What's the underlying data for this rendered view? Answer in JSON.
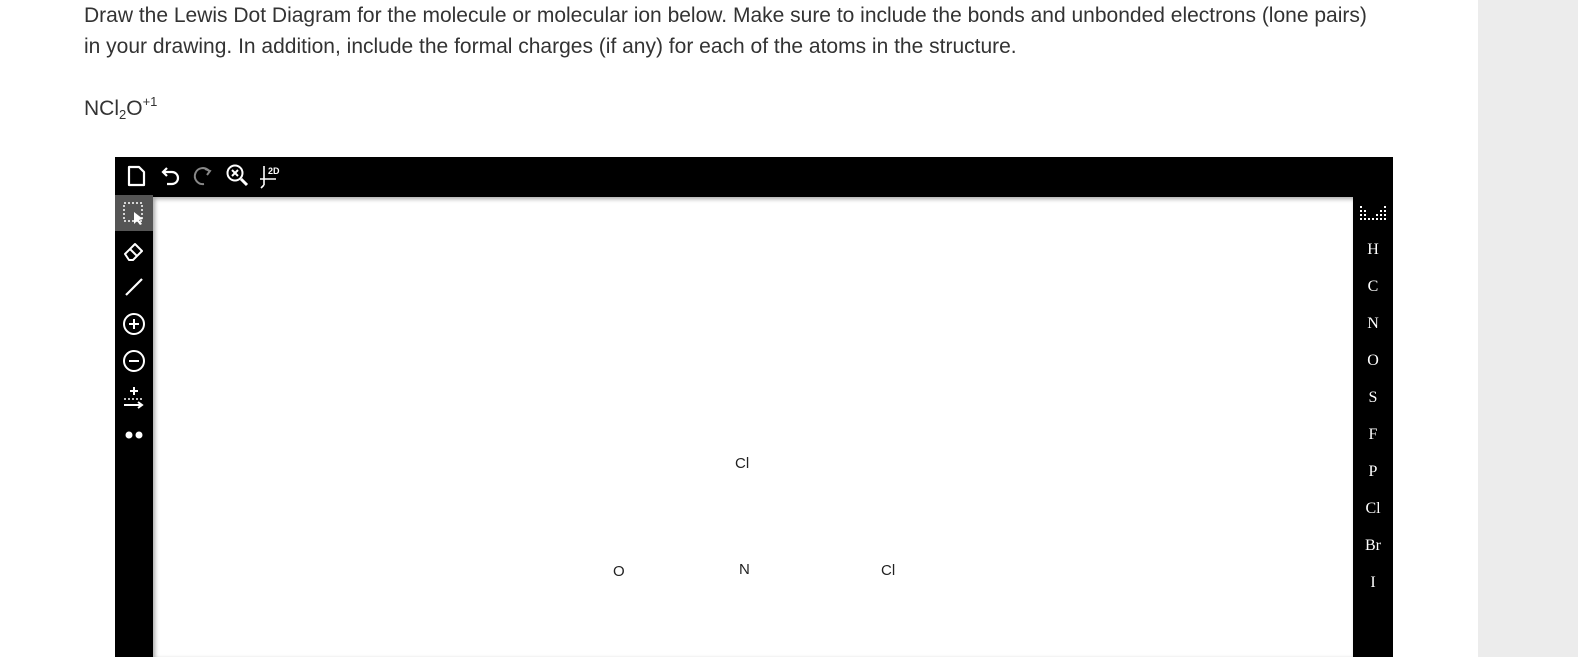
{
  "question": {
    "text": "Draw the Lewis Dot Diagram for the molecule or molecular ion below. Make sure to include the bonds and unbonded electrons (lone pairs) in your drawing. In addition, include the formal charges (if any) for each of the atoms in the structure."
  },
  "formula": {
    "base": "NCl",
    "sub": "2",
    "element2": "O",
    "charge": "+1"
  },
  "toolbar": {
    "new_icon": "new-document-icon",
    "undo_icon": "undo-icon",
    "redo_icon": "redo-icon",
    "zoom_icon": "zoom-reset-icon",
    "clean_label": "2D"
  },
  "tools": [
    "select",
    "erase",
    "bond",
    "charge-plus",
    "charge-minus",
    "charge-shift",
    "lone-pair"
  ],
  "canvas": {
    "atoms": [
      {
        "label": "Cl"
      },
      {
        "label": "O"
      },
      {
        "label": "N"
      },
      {
        "label": "Cl"
      }
    ]
  },
  "elements": [
    "H",
    "C",
    "N",
    "O",
    "S",
    "F",
    "P",
    "Cl",
    "Br",
    "I"
  ],
  "colors": {
    "toolbar": "#000000",
    "canvas": "#ffffff",
    "text": "#333333",
    "gutter": "#ececec"
  }
}
